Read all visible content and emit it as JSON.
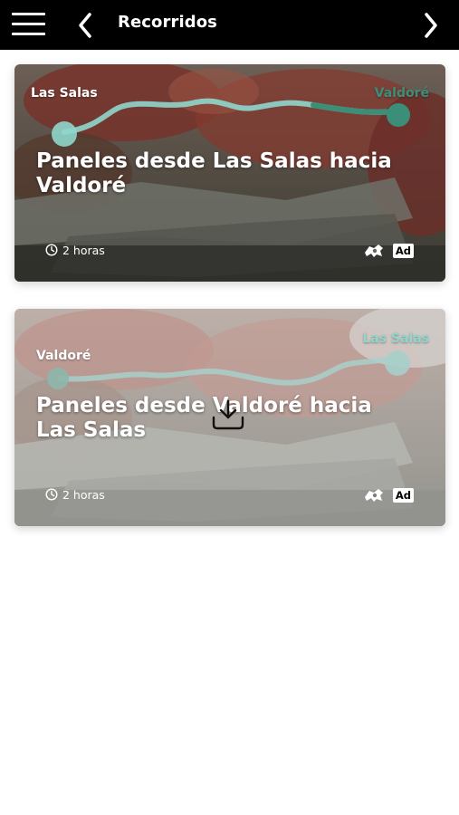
{
  "header": {
    "title": "Recorridos",
    "menu_icon": "hamburger-menu-icon",
    "back_icon": "chevron-left-icon",
    "next_icon": "chevron-right-icon"
  },
  "cards": [
    {
      "start_label": "Las Salas",
      "end_label": "Valdoré",
      "title": "Paneles desde Las Salas hacia Valdoré",
      "duration": "2 horas",
      "ad_badge": "Ad",
      "accessibility_icon": "accessibility-icon",
      "clock_icon": "clock-icon"
    },
    {
      "start_label": "Valdoré",
      "end_label": "Las Salas",
      "title": "Paneles desde Valdoré hacia Las Salas",
      "duration": "2 horas",
      "ad_badge": "Ad",
      "accessibility_icon": "accessibility-icon",
      "clock_icon": "clock-icon",
      "download_icon": "download-icon"
    }
  ],
  "colors": {
    "topbar": "#000000",
    "route_line": "#8fd6cc",
    "route_dark": "#3b8f78",
    "label_light": "#8fd6cc"
  }
}
